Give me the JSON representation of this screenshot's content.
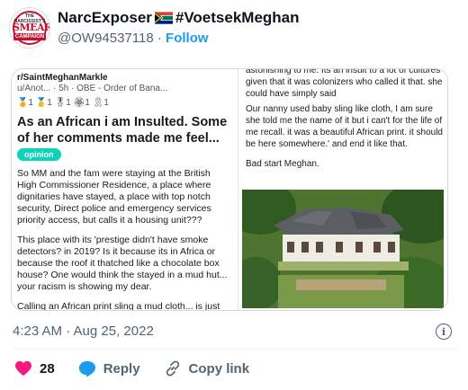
{
  "author": {
    "display_name": "NarcExposer",
    "hashtag": "#VoetsekMeghan",
    "handle": "@OW94537118",
    "separator": "·",
    "follow_label": "Follow",
    "avatar": {
      "top": "THE NARCISSIST'S",
      "main": "SMEAR",
      "sub": "CAMPAIGN"
    }
  },
  "post_image": {
    "reddit_user": "r/SaintMeghanMarkle",
    "reddit_meta": "u/Anot... · 5h · OBE - Order of Bana...",
    "awards": [
      "1",
      "1",
      "1",
      "1",
      "1"
    ],
    "title": "As an African i am Insulted. Some of her comments made me feel...",
    "flair": "opinion",
    "left_paragraphs": [
      "So MM and the fam were staying at the British High Commissioner Residence, a place where dignitaries have stayed, a place with top notch security, Direct police and emergency services priority access, but calls it a housing unit???",
      "This place with its 'prestige didn't have smoke detectors? in 2019? Is it because its in Africa or because the roof it thatched like a chocolate box house? One would think the stayed in a mud hut... your racism is showing my dear.",
      "Calling an African print sling a mud cloth... is just ignorant, for someone who called south"
    ],
    "right_top": "astonishing to me. Its an insult to a lot of cultures given that it was colonizers who called it that. she could have simply said",
    "right_paragraphs": [
      "Our nanny used baby sling like cloth, I am sure she told me the name of it but i can't for the life of me recall. it was a beautiful African print. it should be here somewhere.' and end it like that.",
      "Bad start Meghan."
    ]
  },
  "timestamp": "4:23 AM · Aug 25, 2022",
  "actions": {
    "like_count": "28",
    "reply_label": "Reply",
    "copy_link_label": "Copy link"
  },
  "colors": {
    "link_blue": "#1d9bf0",
    "like_red": "#f91880",
    "muted": "#536471"
  }
}
